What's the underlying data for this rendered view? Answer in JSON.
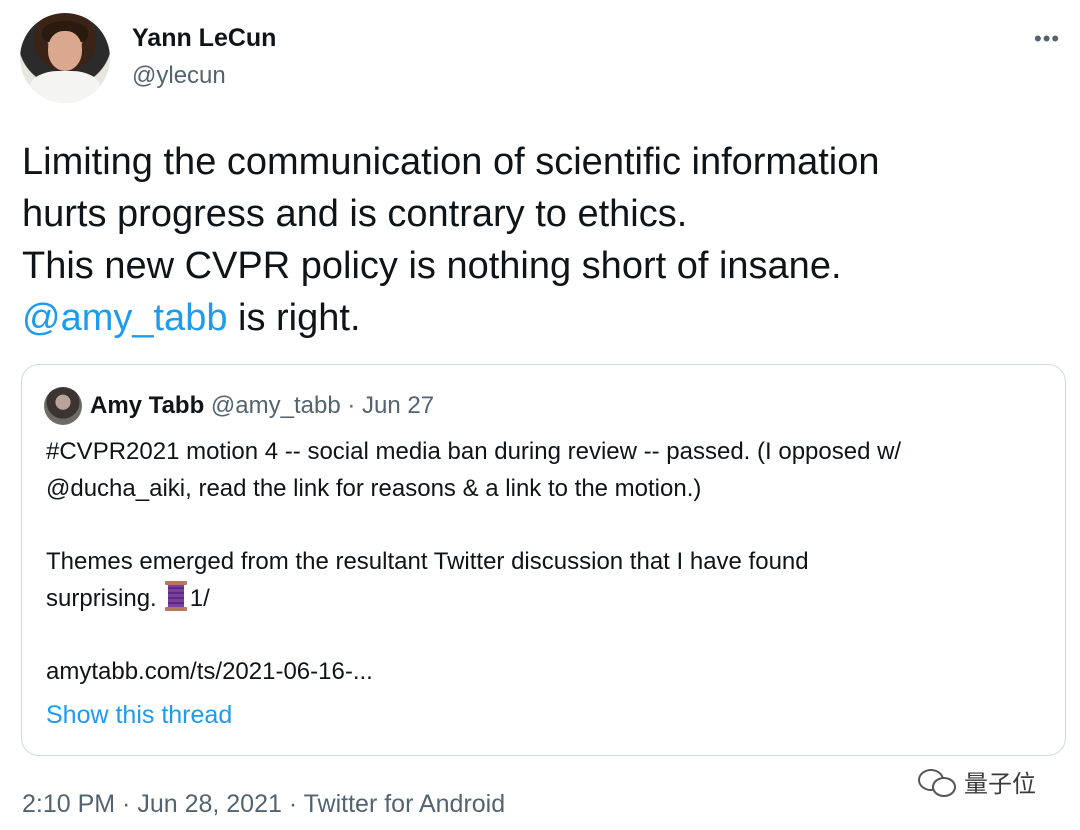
{
  "author": {
    "name": "Yann LeCun",
    "handle": "@ylecun",
    "avatar_icon": "profile-photo"
  },
  "more_icon": "•••",
  "tweet": {
    "lines": [
      "Limiting the communication of scientific information",
      "hurts progress and is contrary to ethics.",
      "This new CVPR policy is nothing short of insane."
    ],
    "mention": "@amy_tabb",
    "mention_suffix": " is right."
  },
  "quoted": {
    "name": "Amy Tabb",
    "meta": " @amy_tabb · Jun 27",
    "lines": [
      "#CVPR2021 motion 4 -- social media ban during review -- passed. (I opposed w/",
      "@ducha_aiki, read the link for reasons & a link to the motion.)"
    ],
    "lines2": [
      "Themes emerged from the resultant Twitter discussion that I have found"
    ],
    "last_line_prefix": "surprising.",
    "last_line_suffix": "1/",
    "thread_icon": "spool-of-thread-emoji",
    "link": "amytabb.com/ts/2021-06-16-...",
    "show_thread": "Show this thread"
  },
  "timestamp": "2:10 PM · Jun 28, 2021 · Twitter for Android",
  "watermark": {
    "icon": "wechat-icon",
    "text": "量子位"
  },
  "colors": {
    "link": "#1d9bf0",
    "secondary_text": "#536471",
    "primary_text": "#0f1419",
    "border": "#cfd9de"
  }
}
